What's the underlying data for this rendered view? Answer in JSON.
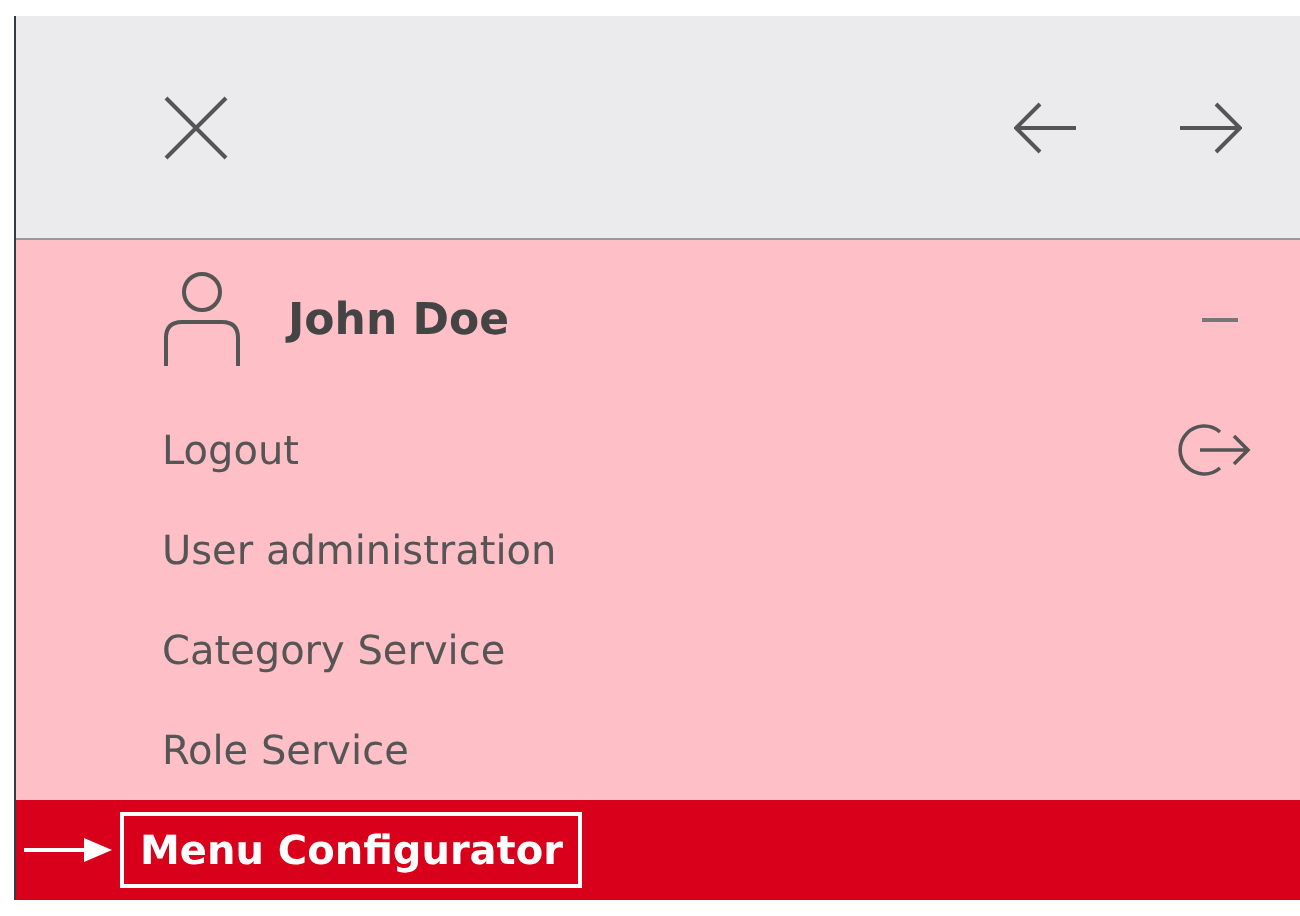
{
  "user": {
    "name": "John Doe",
    "expanded": true
  },
  "menu_items": [
    {
      "label": "Logout",
      "kind": "action",
      "selected": false
    },
    {
      "label": "User administration",
      "kind": "link",
      "selected": false
    },
    {
      "label": "Category Service",
      "kind": "link",
      "selected": false
    },
    {
      "label": "Role Service",
      "kind": "link",
      "selected": false
    },
    {
      "label": "Menu Configurator",
      "kind": "link",
      "selected": true
    }
  ]
}
